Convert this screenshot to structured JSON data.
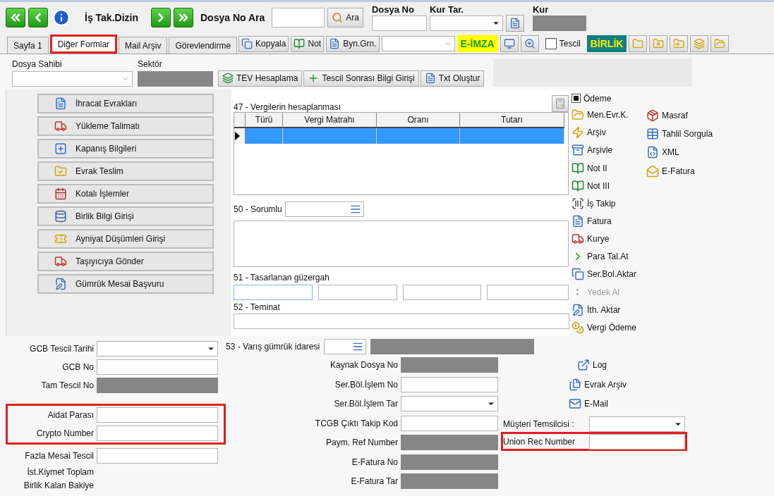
{
  "toolbar": {
    "title": "İş Tak.Dizin",
    "search_label": "Dosya No Ara",
    "search_button": "Ara",
    "dosya_no_label": "Dosya No",
    "kur_tar_label": "Kur Tar.",
    "kur_label": "Kur"
  },
  "tabs": [
    {
      "label": "Sayfa 1",
      "selected": false,
      "highlighted": false
    },
    {
      "label": "Diğer Formlar",
      "selected": true,
      "highlighted": true
    },
    {
      "label": "Mail Arşiv",
      "selected": false,
      "highlighted": false
    },
    {
      "label": "Görevlendirme",
      "selected": false,
      "highlighted": false
    }
  ],
  "tool_buttons": [
    "Kopyala",
    "Not",
    "Byn.Grn."
  ],
  "e_imza": "E-İMZA",
  "tescil": {
    "label": "Tescil",
    "checked": false
  },
  "birlik": "BİRLİK",
  "header": {
    "owner_label": "Dosya Sahibi",
    "sector_label": "Sektör",
    "actions": [
      "TEV Hesaplama",
      "Tescil Sonrası Bilgi Girişi",
      "Txt Oluştur"
    ]
  },
  "side_buttons": [
    "İhracat Evrakları",
    "Yükleme Talimatı",
    "Kapanış Bilgileri",
    "Evrak Teslim",
    "Kotalı İşlemler",
    "Birlik Bilgi Girişi",
    "Ayniyat Düşümleri Girişi",
    "Taşıyıcıya Gönder",
    "Gümrük Mesai Başvuru"
  ],
  "tax_table": {
    "title": "47 - Vergilerin hesaplanması",
    "columns": [
      "Türü",
      "Vergi Matrahı",
      "Oranı",
      "Tutarı"
    ],
    "rows": [
      {
        "selected": true
      }
    ]
  },
  "sorumlu_label": "50 - Sorumlu",
  "route_label": "51 - Tasarlanan güzergah",
  "teminat_label": "52 - Teminat",
  "odeme": {
    "label": "Ödeme",
    "checked": true
  },
  "links_col1": [
    {
      "label": "Men.Evr.K.",
      "disabled": false
    },
    {
      "label": "Arşiv",
      "disabled": false
    },
    {
      "label": "Arşivle",
      "disabled": false
    },
    {
      "label": "Not II",
      "disabled": false
    },
    {
      "label": "Not III",
      "disabled": false
    },
    {
      "label": "İş Takip",
      "disabled": false
    },
    {
      "label": "Fatura",
      "disabled": false
    },
    {
      "label": "Kurye",
      "disabled": false
    },
    {
      "label": "Para Tal.At",
      "disabled": false
    },
    {
      "label": "Ser.Bol.Aktar",
      "disabled": false
    },
    {
      "label": "Yedek Al",
      "disabled": true
    },
    {
      "label": "İth. Aktar",
      "disabled": false
    },
    {
      "label": "Vergi Ödeme",
      "disabled": false
    }
  ],
  "links_col2": [
    {
      "label": "Masraf",
      "disabled": false
    },
    {
      "label": "Tahlil Sorgula",
      "disabled": false
    },
    {
      "label": "XML",
      "disabled": false
    },
    {
      "label": "E-Fatura",
      "disabled": false
    }
  ],
  "left_form": [
    {
      "highlighted": false,
      "rows": [
        {
          "label": "GCB Tescil Tarihi",
          "kind": "combo"
        },
        {
          "label": "GCB No",
          "kind": "text"
        },
        {
          "label": "Tam Tescil No",
          "kind": "readonly"
        }
      ]
    },
    {
      "highlighted": true,
      "rows": [
        {
          "label": "Aidat Parası",
          "kind": "text"
        },
        {
          "label": "Crypto Number",
          "kind": "text"
        }
      ]
    },
    {
      "highlighted": false,
      "rows": [
        {
          "label": "Fazla Mesai Tescil",
          "kind": "text"
        },
        {
          "label": "İst.Kiymet Toplam",
          "kind": "none"
        },
        {
          "label": "Birlik Kalan Bakiye",
          "kind": "none"
        }
      ]
    }
  ],
  "destination_row": {
    "label": "53 - Varış gümrük idaresi"
  },
  "middle_form": [
    {
      "label": "Kaynak Dosya No",
      "kind": "readonly"
    },
    {
      "label": "Ser.Böl.İşlem No",
      "kind": "text"
    },
    {
      "label": "Ser.Böl.İşlem Tar",
      "kind": "combo"
    },
    {
      "label": "TCGB Çıktı Takip Kod",
      "kind": "text"
    },
    {
      "label": "Paym. Ref Number",
      "kind": "readonly"
    },
    {
      "label": "E-Fatura No",
      "kind": "readonly"
    },
    {
      "label": "E-Fatura Tar",
      "kind": "readonly"
    }
  ],
  "lower_links": [
    "Log",
    "Evrak Arşiv",
    "E-Mail"
  ],
  "right_form": [
    {
      "label": "Müşteri Temsilcisi :",
      "kind": "combo",
      "highlighted": false
    },
    {
      "label": "Union Rec Number",
      "kind": "text",
      "highlighted": true
    }
  ]
}
